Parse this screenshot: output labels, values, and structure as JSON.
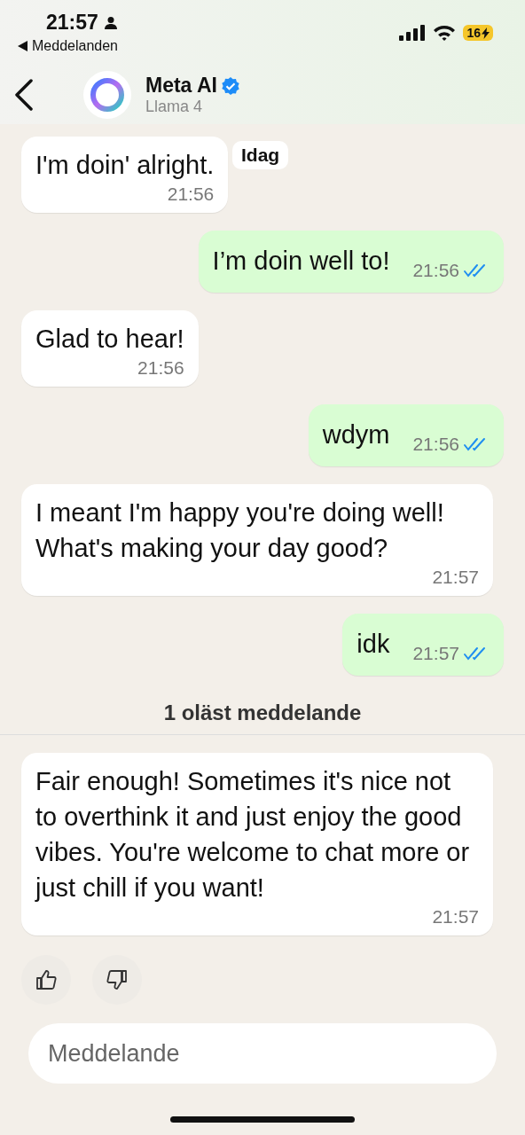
{
  "status_bar": {
    "time": "21:57",
    "back_app": "Meddelanden",
    "battery": "16"
  },
  "header": {
    "name": "Meta AI",
    "verified": true,
    "subtitle": "Llama 4"
  },
  "date_chip": "Idag",
  "messages": [
    {
      "kind": "incoming",
      "text": "I'm doin' alright.",
      "time": "21:56"
    },
    {
      "kind": "outgoing",
      "text": "I’m doin well to!",
      "time": "21:56",
      "read": true
    },
    {
      "kind": "incoming",
      "text": "Glad to hear!",
      "time": "21:56"
    },
    {
      "kind": "outgoing",
      "text": "wdym",
      "time": "21:56",
      "read": true
    },
    {
      "kind": "incoming",
      "text": "I meant I'm happy you're doing well! What's making your day good?",
      "time": "21:57"
    },
    {
      "kind": "outgoing",
      "text": "idk",
      "time": "21:57",
      "read": true
    },
    {
      "kind": "divider",
      "text": "1 oläst meddelande"
    },
    {
      "kind": "incoming",
      "text": "Fair enough! Sometimes it's nice not to overthink it and just enjoy the good vibes. You're welcome to chat more or just chill if you want!",
      "time": "21:57"
    }
  ],
  "composer": {
    "placeholder": "Meddelande"
  }
}
